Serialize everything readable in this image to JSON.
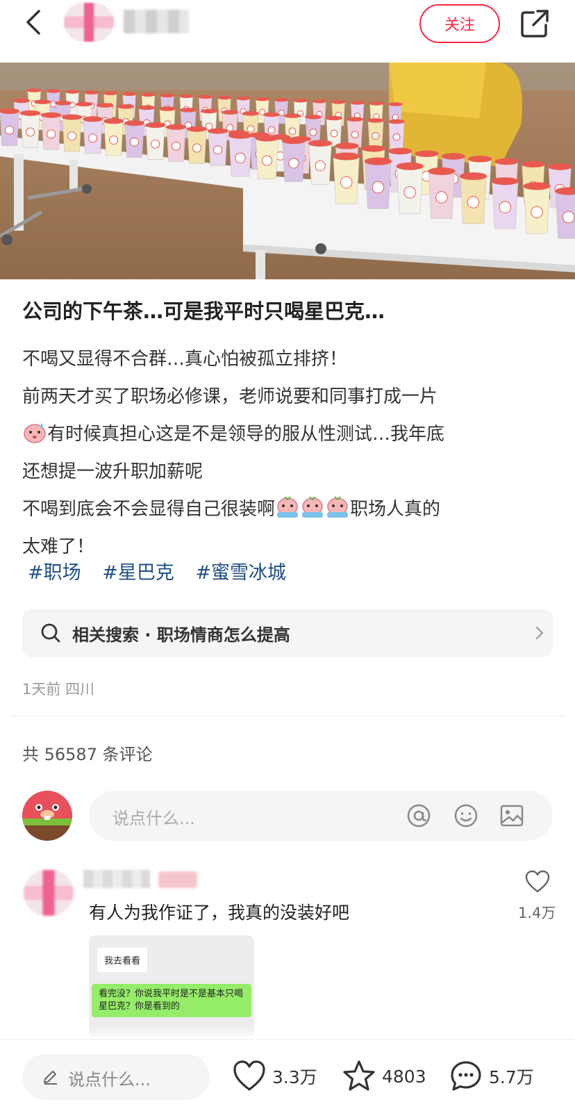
{
  "header": {
    "author_name": "▒▒▒▒",
    "follow_label": "关注"
  },
  "post": {
    "title": "公司的下午茶…可是我平时只喝星巴克…",
    "lines": [
      "不喝又显得不合群…真心怕被孤立排挤！",
      "前两天才买了职场必修课，老师说要和同事打成一片",
      "有时候真担心这是不是领导的服从性测试…我年底",
      "还想提一波升职加薪呢",
      "不喝到底会不会显得自己很装啊",
      "职场人真的",
      "太难了！"
    ],
    "tags": [
      "#职场",
      "#星巴克",
      "#蜜雪冰城"
    ],
    "related_search": "相关搜索 · 职场情商怎么提高",
    "time_location": "1天前 四川"
  },
  "comments": {
    "count_label": "共 56587 条评论",
    "input_placeholder": "说点什么...",
    "items": [
      {
        "name": "▒▒▒▒",
        "badge": "▒▒",
        "text": "有人为我作证了，我真的没装好吧",
        "likes": "1.4万",
        "chat": {
          "white_bubble": "我去看看",
          "green_bubble": "看完没？你说我平时是不是基本只喝星巴克？你是看到的"
        }
      }
    ]
  },
  "bottom_bar": {
    "input_placeholder": "说点什么...",
    "likes": "3.3万",
    "stars": "4803",
    "comments": "5.7万"
  },
  "colors": {
    "accent": "#ff2442",
    "tag": "#1e4f87",
    "chat_green": "#95ec69"
  },
  "icons": [
    "back-arrow-icon",
    "share-icon",
    "search-icon",
    "chevron-right-icon",
    "at-icon",
    "smile-icon",
    "image-icon",
    "heart-icon",
    "star-icon",
    "comment-icon",
    "pen-icon"
  ]
}
